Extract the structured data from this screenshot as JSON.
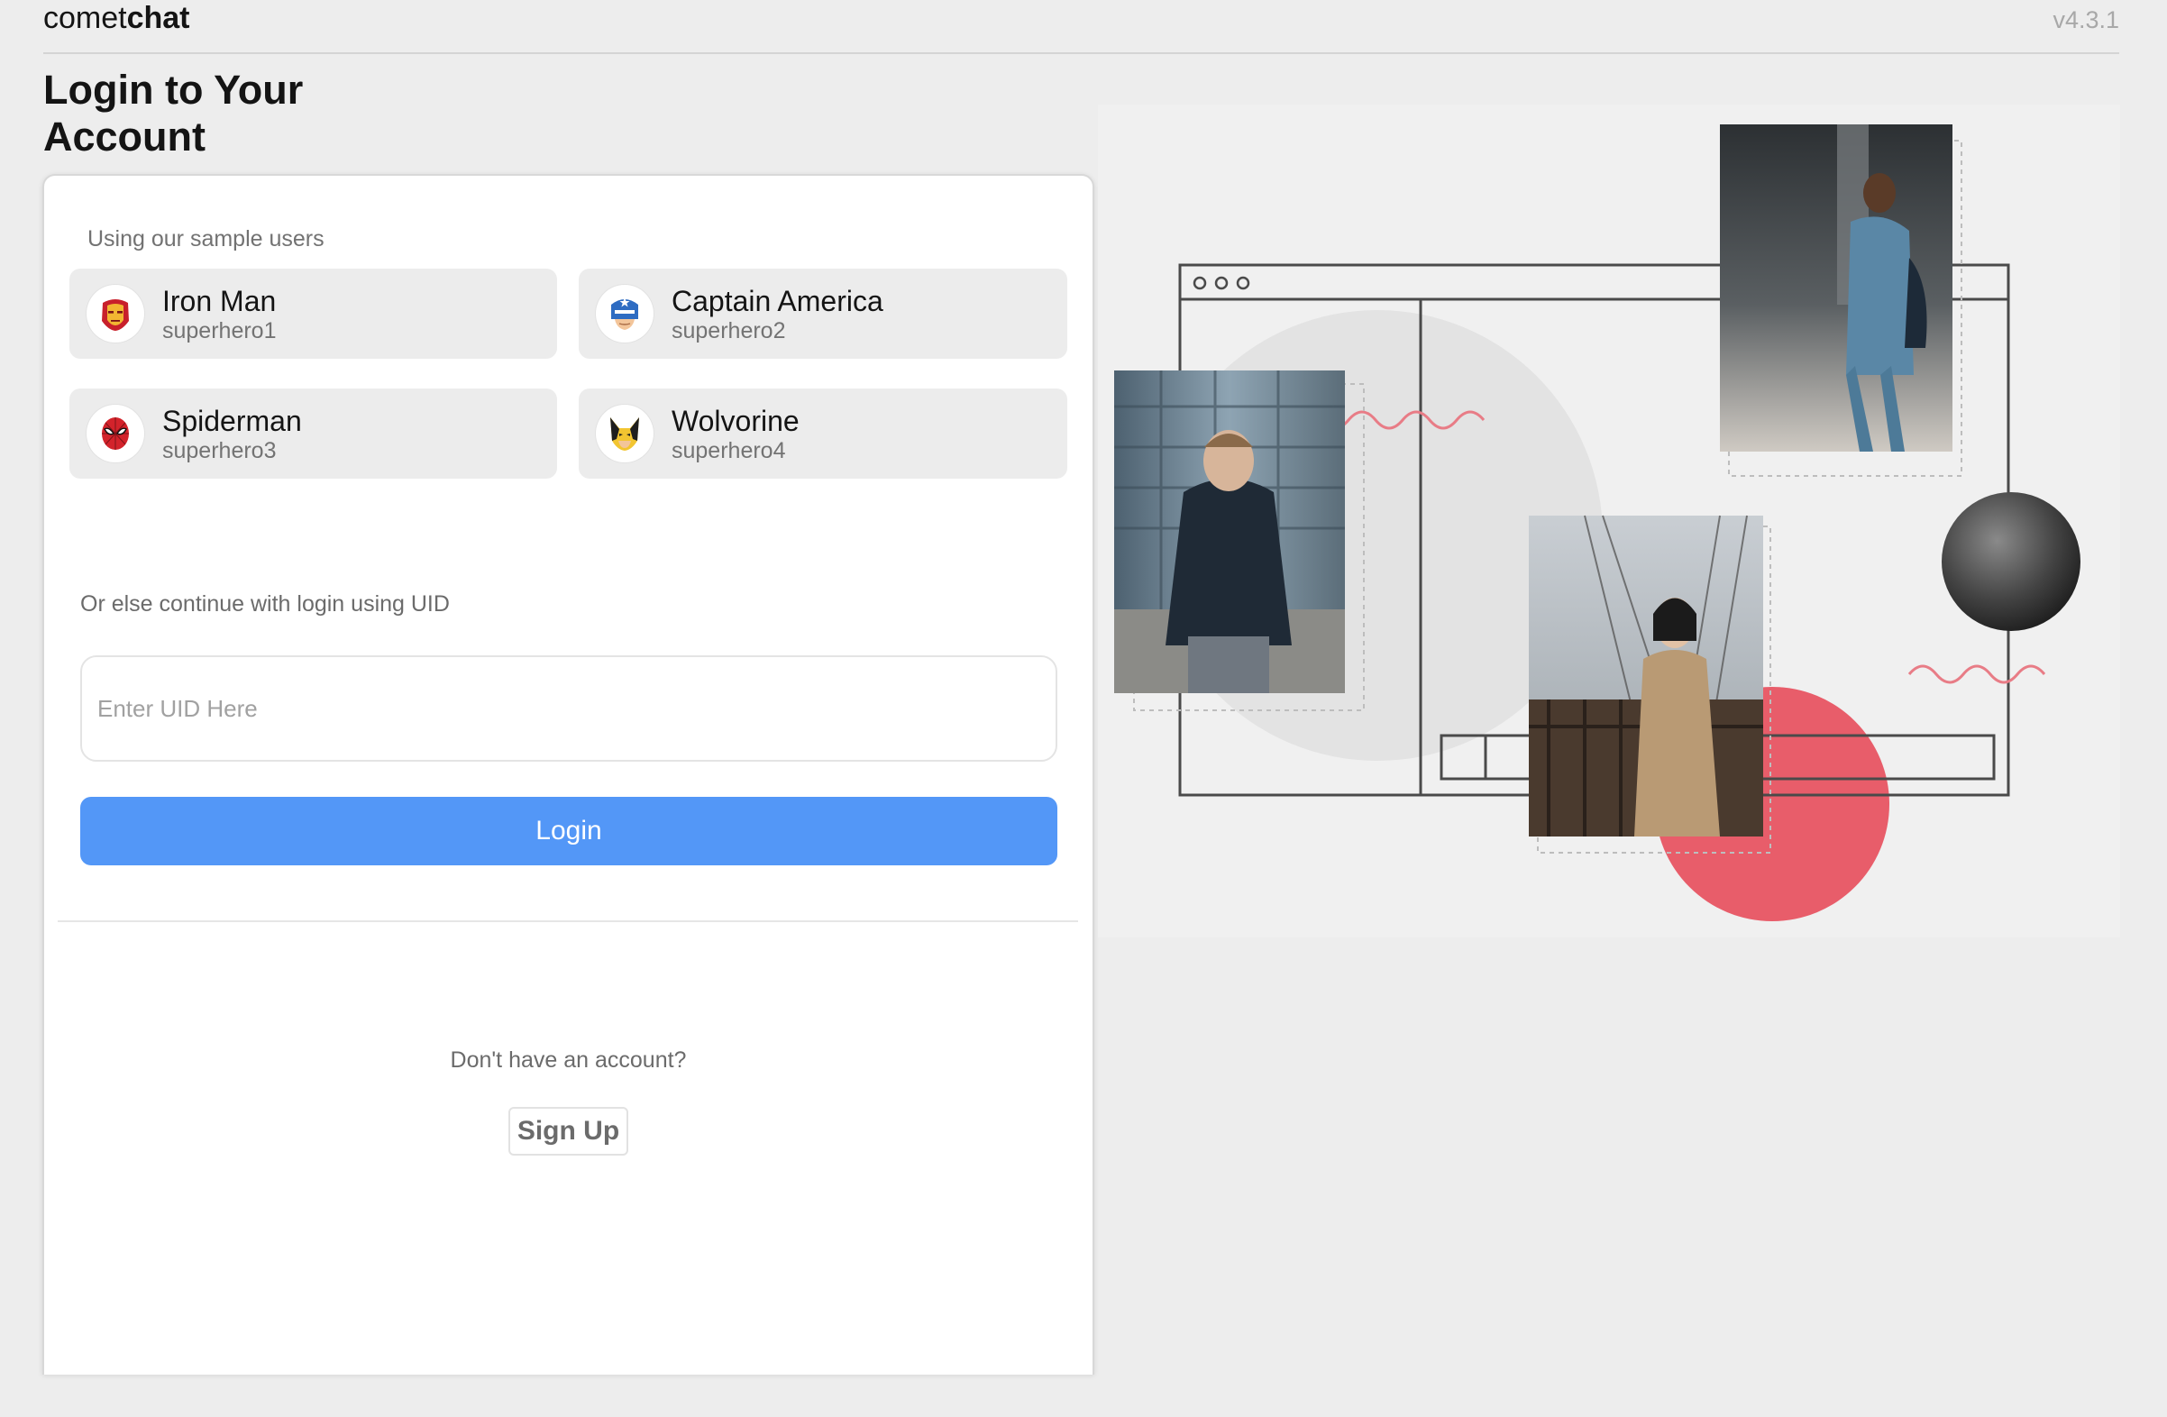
{
  "header": {
    "brand_light": "comet",
    "brand_bold": "chat",
    "version": "v4.3.1"
  },
  "page_title": "Login to Your Account",
  "sample_users": {
    "label": "Using our sample users",
    "users": [
      {
        "name": "Iron Man",
        "uid": "superhero1",
        "icon": "iron-man-icon"
      },
      {
        "name": "Captain America",
        "uid": "superhero2",
        "icon": "captain-america-icon"
      },
      {
        "name": "Spiderman",
        "uid": "superhero3",
        "icon": "spiderman-icon"
      },
      {
        "name": "Wolvorine",
        "uid": "superhero4",
        "icon": "wolverine-icon"
      }
    ]
  },
  "uid_login": {
    "label": "Or else continue with login using UID",
    "placeholder": "Enter UID Here",
    "value": "",
    "button_label": "Login"
  },
  "signup": {
    "prompt": "Don't have an account?",
    "button_label": "Sign Up"
  },
  "colors": {
    "accent": "#5397f7",
    "illustration_accent": "#e85d6a"
  }
}
